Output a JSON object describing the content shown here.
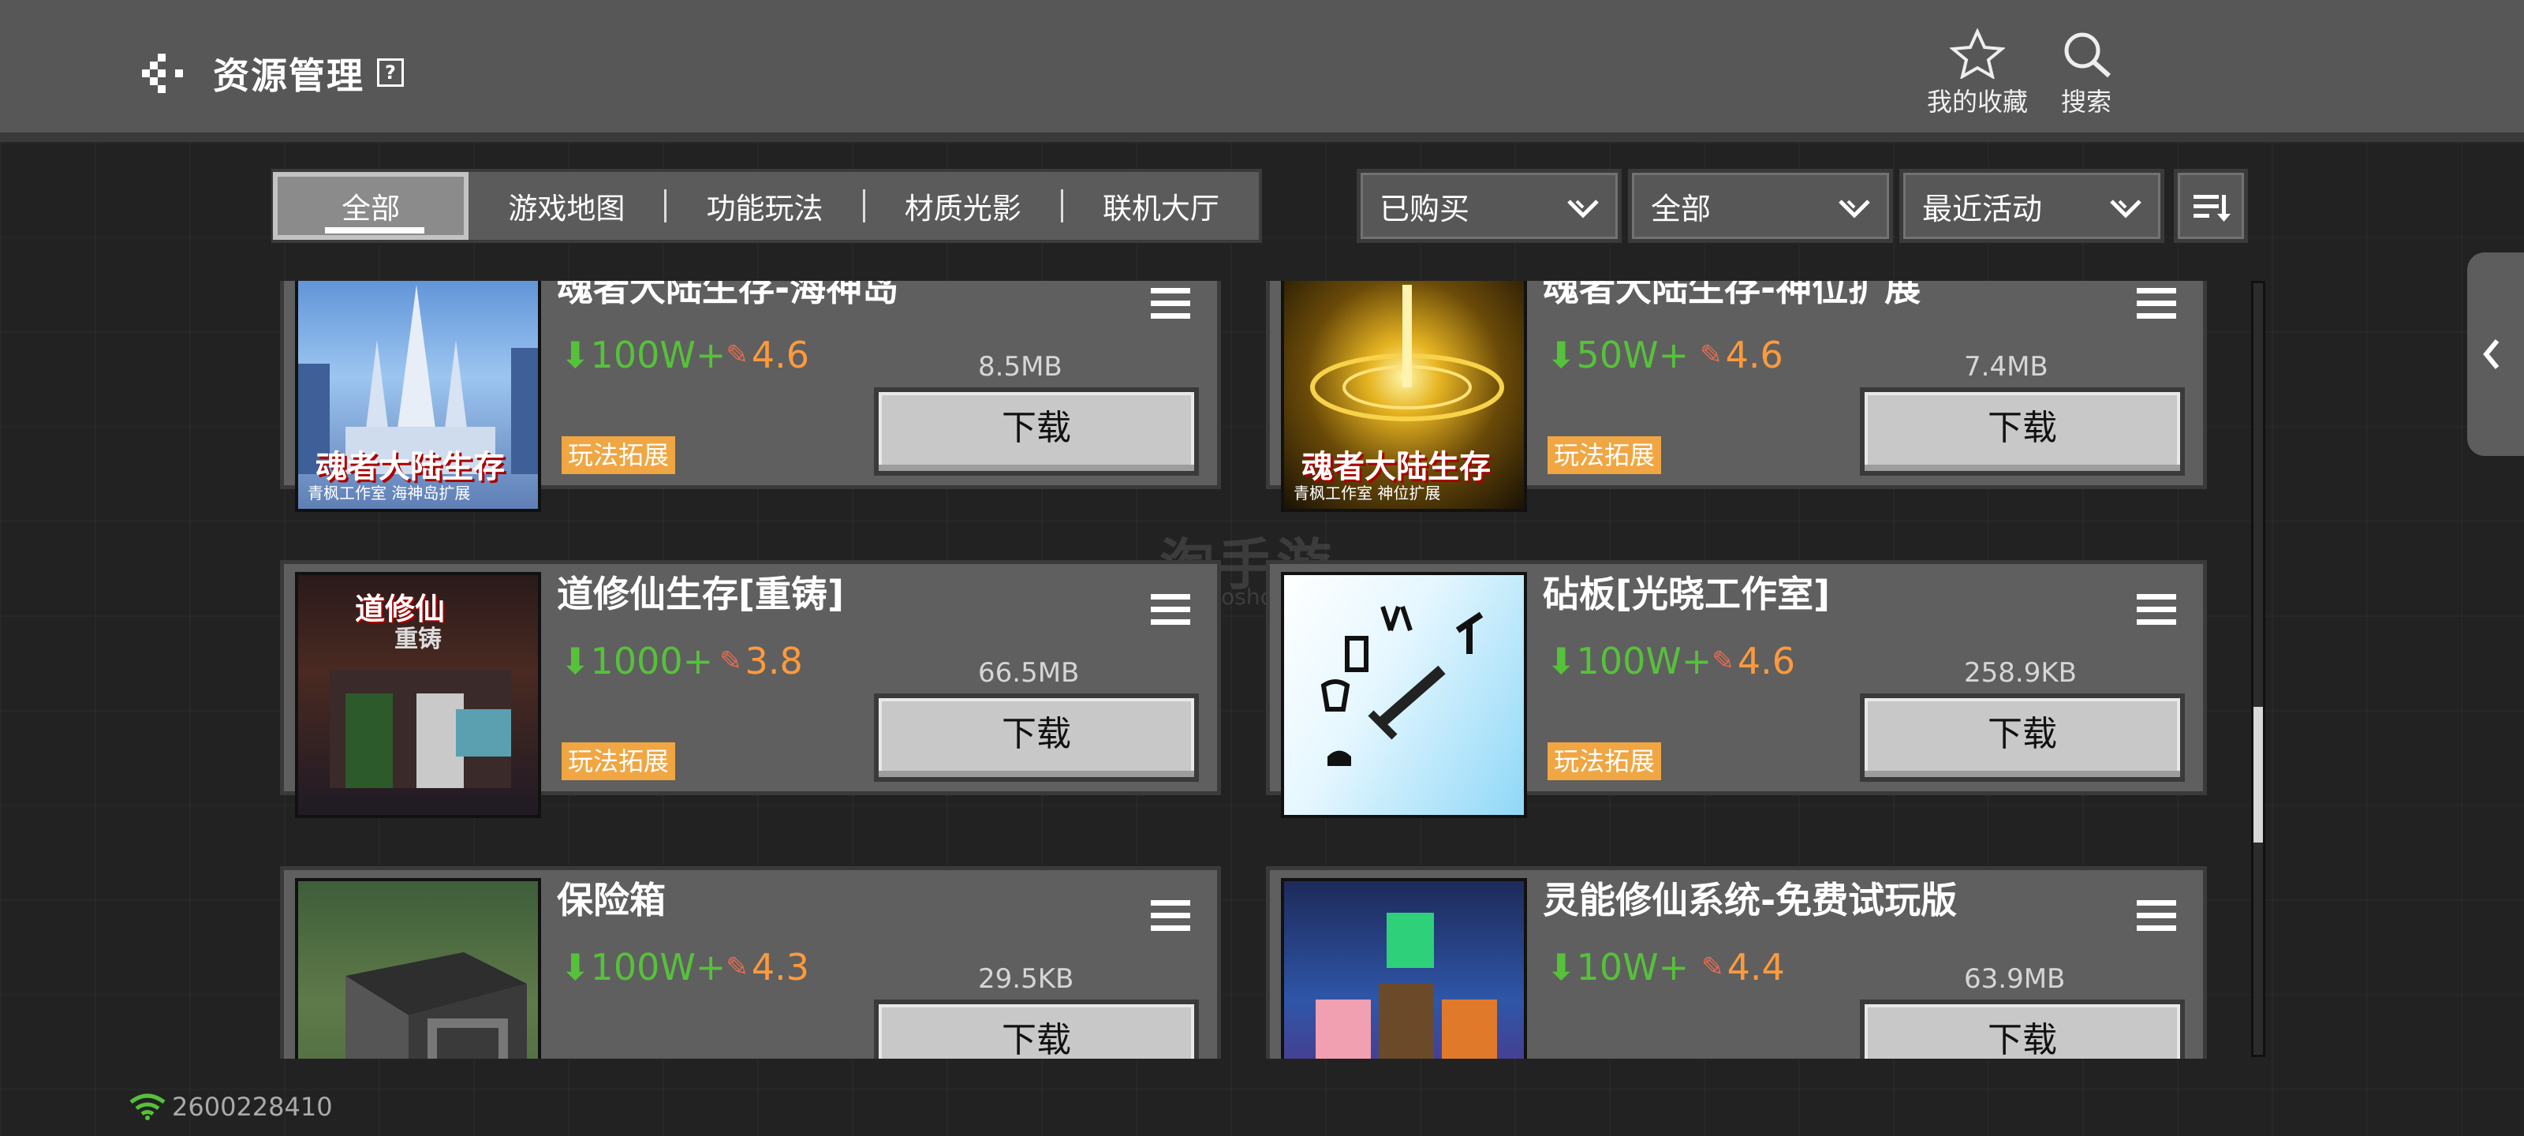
{
  "header": {
    "title": "资源管理",
    "help_icon": "?",
    "favorites_label": "我的收藏",
    "search_label": "搜索"
  },
  "tabs": [
    {
      "label": "全部",
      "active": true
    },
    {
      "label": "游戏地图"
    },
    {
      "label": "功能玩法"
    },
    {
      "label": "材质光影"
    },
    {
      "label": "联机大厅"
    }
  ],
  "filters": {
    "purchase": "已购买",
    "category": "全部",
    "sort": "最近活动"
  },
  "items": [
    {
      "name": "魂者大陆生存-海神岛",
      "downloads": "100W+",
      "rating": "4.6",
      "size": "8.5MB",
      "button": "下载",
      "tag": "玩法拓展",
      "thumb_text": "魂者大陆生存",
      "thumb_sub": "青枫工作室 海神岛扩展"
    },
    {
      "name": "魂者大陆生存-神位扩展",
      "downloads": "50W+",
      "rating": "4.6",
      "size": "7.4MB",
      "button": "下载",
      "tag": "玩法拓展",
      "thumb_text": "魂者大陆生存",
      "thumb_sub": "青枫工作室 神位扩展"
    },
    {
      "name": "道修仙生存[重铸]",
      "downloads": "1000+",
      "rating": "3.8",
      "size": "66.5MB",
      "button": "下载",
      "tag": "玩法拓展",
      "thumb_text": "道修仙",
      "thumb_sub": "重铸"
    },
    {
      "name": "砧板[光晓工作室]",
      "downloads": "100W+",
      "rating": "4.6",
      "size": "258.9KB",
      "button": "下载",
      "tag": "玩法拓展"
    },
    {
      "name": "保险箱",
      "downloads": "100W+",
      "rating": "4.3",
      "size": "29.5KB",
      "button": "下载"
    },
    {
      "name": "灵能修仙系统-免费试玩版",
      "downloads": "10W+",
      "rating": "4.4",
      "size": "63.9MB",
      "button": "下载"
    }
  ],
  "status": {
    "network_id": "2600228410"
  },
  "watermark": {
    "text": "淘手游",
    "sub": "taoshouyou"
  },
  "colors": {
    "download": "#56c13a",
    "rating": "#ff9a3c",
    "tag": "#f0a642"
  }
}
